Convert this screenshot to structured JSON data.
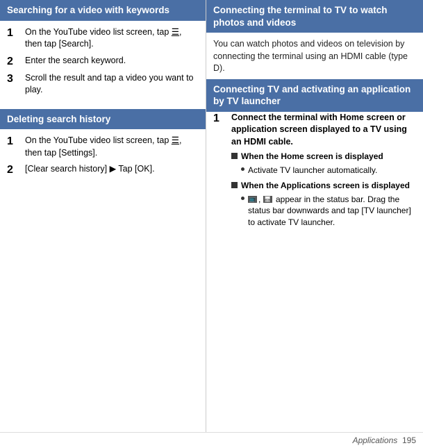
{
  "left": {
    "section1": {
      "header": "Searching for a video with keywords",
      "steps": [
        {
          "number": "1",
          "text": "On the YouTube video list screen, tap [menu], then tap [Search]."
        },
        {
          "number": "2",
          "text": "Enter the search keyword."
        },
        {
          "number": "3",
          "text": "Scroll the result and tap a video you want to play."
        }
      ]
    },
    "section2": {
      "header": "Deleting search history",
      "steps": [
        {
          "number": "1",
          "text": "On the YouTube video list screen, tap [menu], then tap [Settings]."
        },
        {
          "number": "2",
          "text": "[Clear search history] ▶ Tap [OK]."
        }
      ]
    }
  },
  "right": {
    "section1": {
      "header": "Connecting the terminal to TV to watch photos and videos",
      "intro": "You can watch photos and videos on television by connecting the terminal using an HDMI cable (type D)."
    },
    "section2": {
      "header": "Connecting TV and activating an application by TV launcher",
      "steps": [
        {
          "number": "1",
          "text": "Connect the terminal with Home screen or application screen displayed to a TV using an HDMI cable.",
          "subgroups": [
            {
              "heading": "When the Home screen is displayed",
              "items": [
                "Activate TV launcher automatically."
              ]
            },
            {
              "heading": "When the Applications screen is displayed",
              "items": [
                "[tv-icon], [screen-icon] appear in the status bar. Drag the status bar downwards and tap [TV launcher] to activate TV launcher."
              ]
            }
          ]
        }
      ]
    }
  },
  "footer": {
    "section": "Applications",
    "page": "195"
  }
}
